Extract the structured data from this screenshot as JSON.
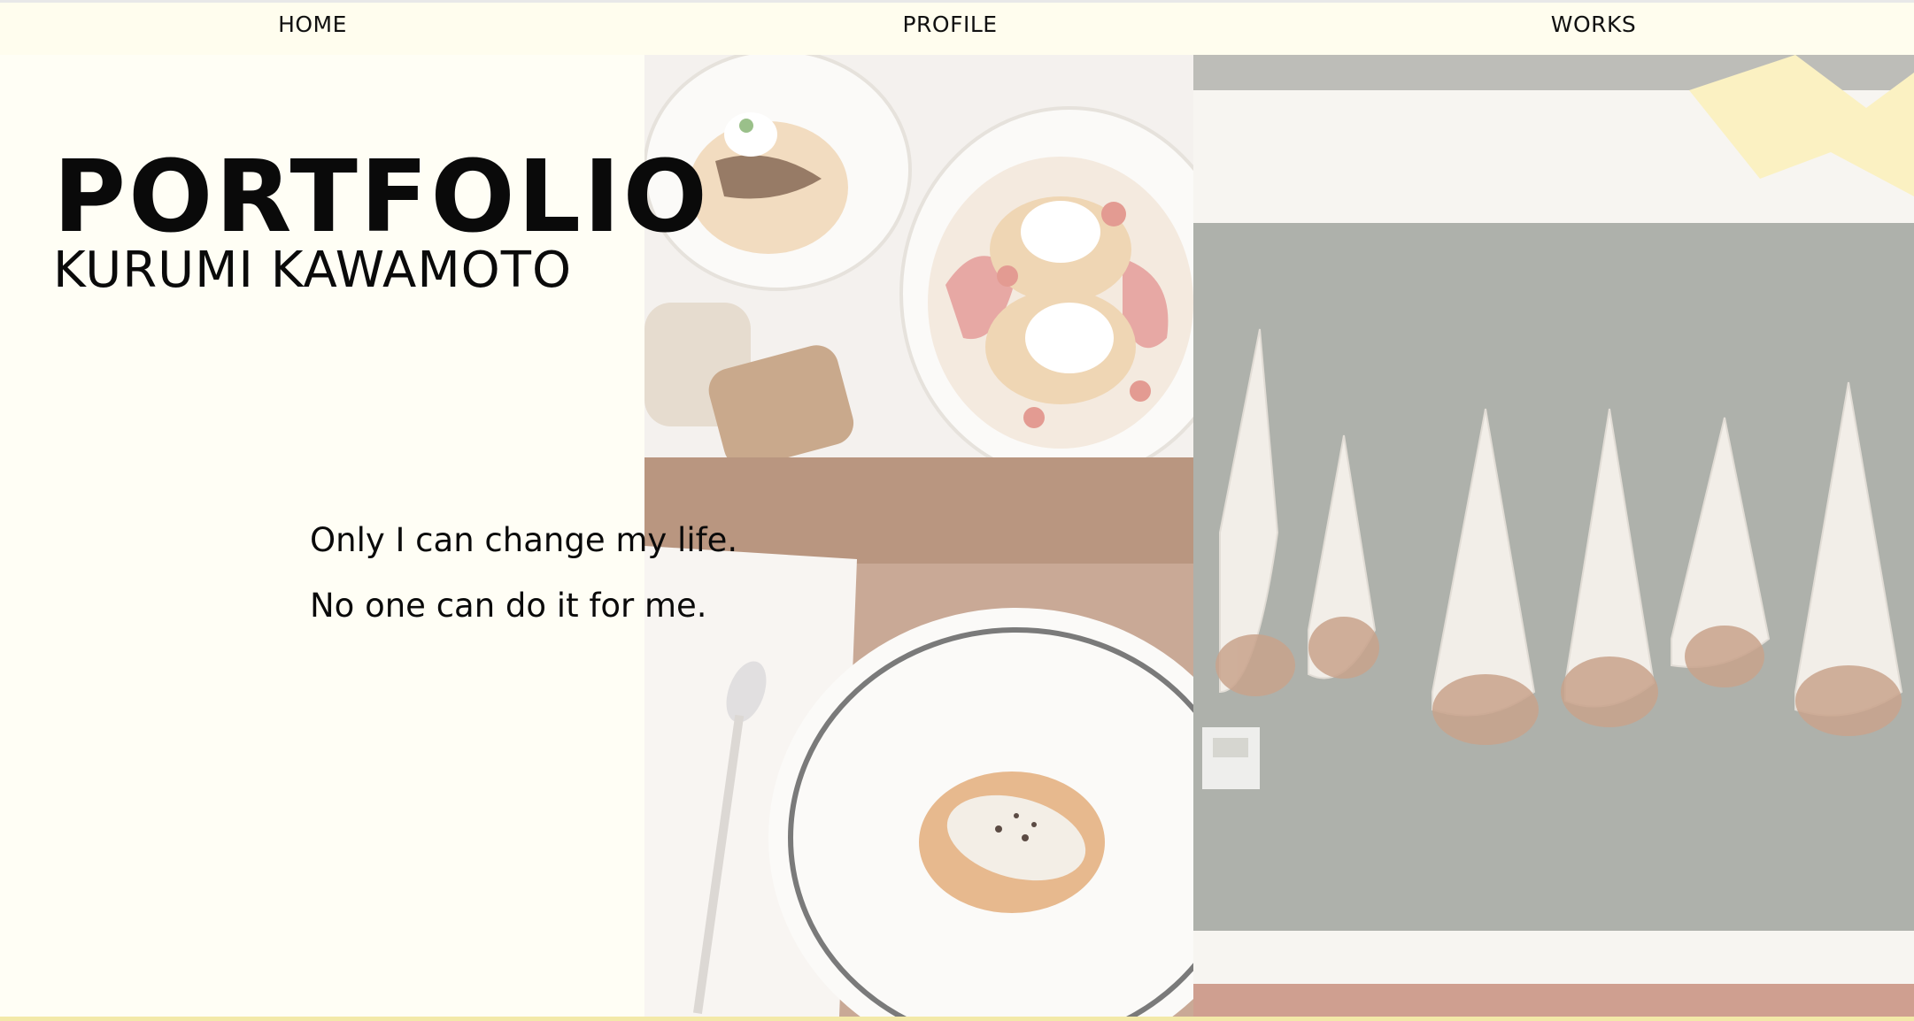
{
  "nav": {
    "home": "HOME",
    "profile": "PROFILE",
    "works": "WORKS"
  },
  "hero": {
    "title": "PORTFOLIO",
    "name": "KURUMI KAWAMOTO",
    "quote_line_1": "Only I can change my life.",
    "quote_line_2": "No one can do it for me."
  },
  "colors": {
    "background": "#fffef5",
    "nav_background": "#fffdee",
    "text": "#0a0a0a"
  }
}
